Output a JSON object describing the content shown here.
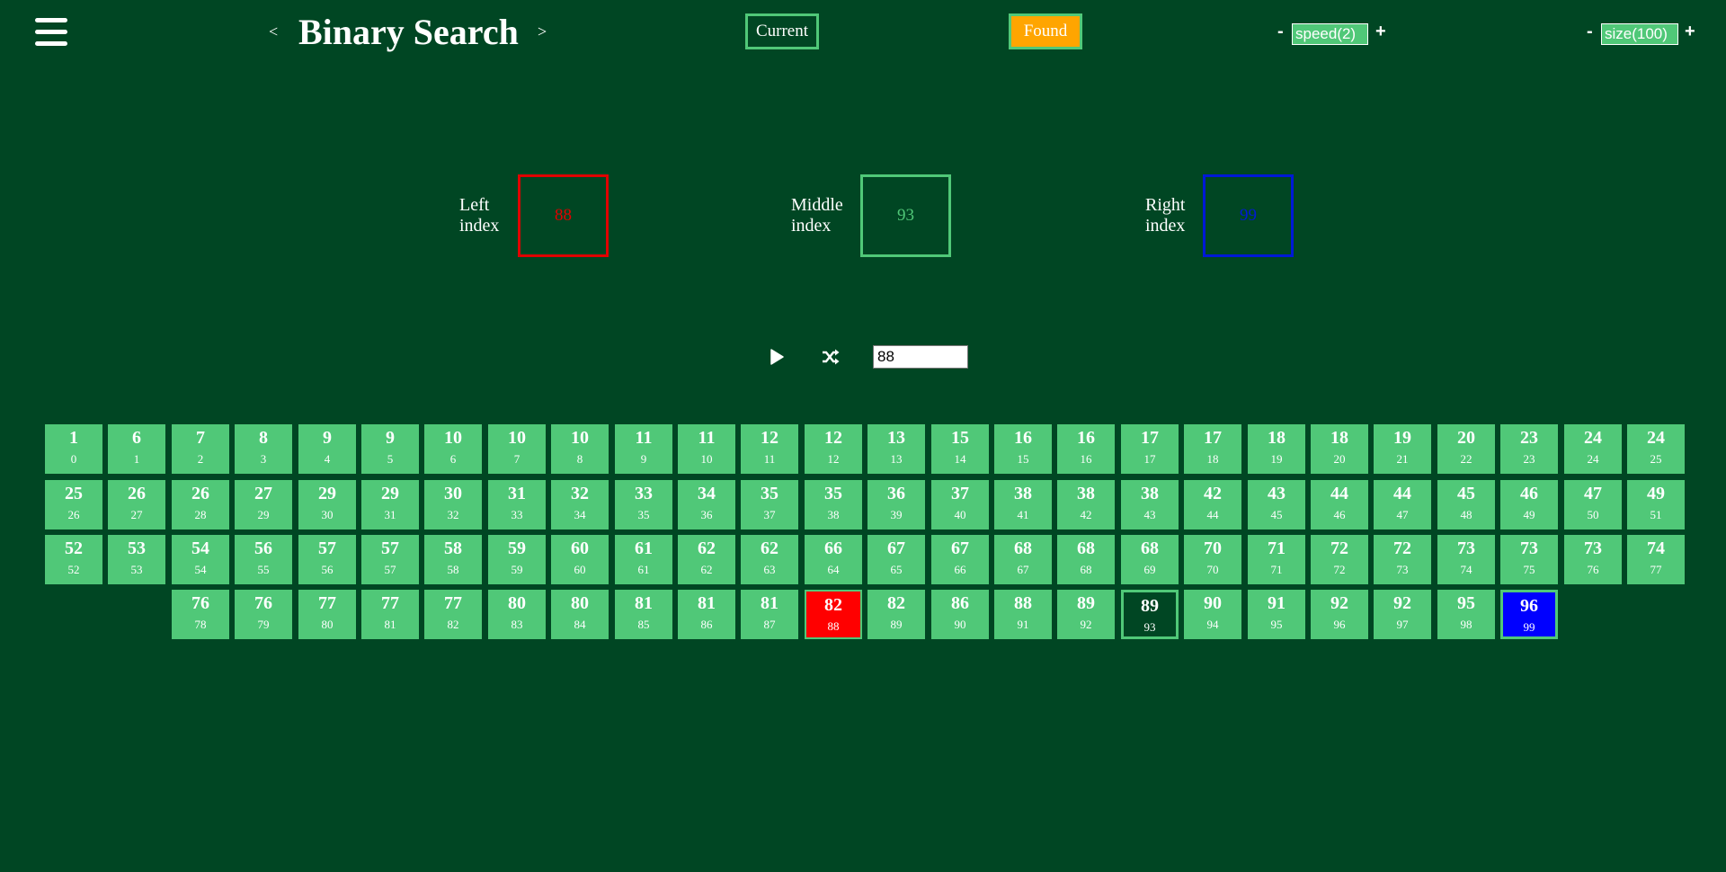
{
  "header": {
    "title": "Binary Search",
    "prev_arrow": "<",
    "next_arrow": ">",
    "legend_current": "Current",
    "legend_found": "Found",
    "speed_minus": "-",
    "speed_label": "speed(2)",
    "speed_plus": "+",
    "size_minus": "-",
    "size_label": "size(100)",
    "size_plus": "+"
  },
  "indices": {
    "left": {
      "label_line1": "Left",
      "label_line2": "index",
      "value": "88",
      "color": "#e00000"
    },
    "middle": {
      "label_line1": "Middle",
      "label_line2": "index",
      "value": "93",
      "color": "#50c878"
    },
    "right": {
      "label_line1": "Right",
      "label_line2": "index",
      "value": "99",
      "color": "#0019d6"
    }
  },
  "controls": {
    "play_icon": "play-icon",
    "shuffle_icon": "shuffle-icon",
    "target_value": "88"
  },
  "colors": {
    "background": "#004623",
    "cell": "#50c878",
    "left": "#ff0000",
    "middle": "#004623",
    "right": "#0000ff",
    "found": "#ffa500"
  },
  "array": {
    "values": [
      1,
      6,
      7,
      8,
      9,
      9,
      10,
      10,
      10,
      11,
      11,
      12,
      12,
      13,
      15,
      16,
      16,
      17,
      17,
      18,
      18,
      19,
      20,
      23,
      24,
      24,
      25,
      26,
      26,
      27,
      29,
      29,
      30,
      31,
      32,
      33,
      34,
      35,
      35,
      36,
      37,
      38,
      38,
      38,
      42,
      43,
      44,
      44,
      45,
      46,
      47,
      49,
      52,
      53,
      54,
      56,
      57,
      57,
      58,
      59,
      60,
      61,
      62,
      62,
      66,
      67,
      67,
      68,
      68,
      68,
      70,
      71,
      72,
      72,
      73,
      73,
      73,
      74,
      76,
      76,
      77,
      77,
      77,
      80,
      80,
      81,
      81,
      81,
      82,
      82,
      86,
      88,
      89,
      89,
      90,
      91,
      92,
      92,
      95,
      96
    ],
    "left_index": 88,
    "middle_index": 93,
    "right_index": 99
  }
}
